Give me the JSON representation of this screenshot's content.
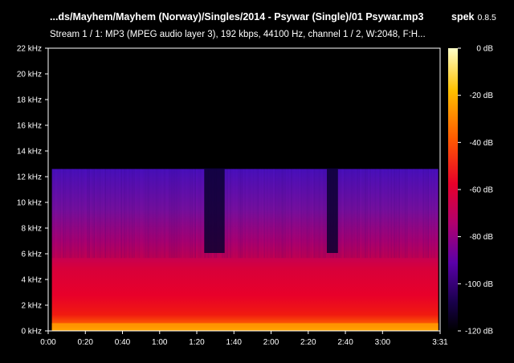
{
  "header": {
    "title": "...ds/Mayhem/Mayhem (Norway)/Singles/2014 - Psywar (Single)/01 Psywar.mp3",
    "app_name": "spek",
    "app_version": "0.8.5",
    "stream_info": "Stream 1 / 1: MP3 (MPEG audio layer 3), 192 kbps, 44100 Hz, channel 1 / 2, W:2048, F:H..."
  },
  "colors": {
    "background": "#000000",
    "text": "#ffffff",
    "palette": [
      "#000000",
      "#18004a",
      "#5a00a8",
      "#b0006e",
      "#e8002a",
      "#ff5a00",
      "#ffc000",
      "#ffffc8"
    ]
  },
  "chart_data": {
    "type": "heatmap",
    "title": "",
    "xlabel": "",
    "ylabel": "",
    "x_range": [
      "0:00",
      "3:31"
    ],
    "y_range_khz": [
      0,
      22
    ],
    "x_ticks": [
      "0:00",
      "0:20",
      "0:40",
      "1:00",
      "1:20",
      "1:40",
      "2:00",
      "2:20",
      "2:40",
      "3:00",
      "3:31"
    ],
    "y_ticks": [
      "0 kHz",
      "2 kHz",
      "4 kHz",
      "6 kHz",
      "8 kHz",
      "10 kHz",
      "12 kHz",
      "14 kHz",
      "16 kHz",
      "18 kHz",
      "20 kHz",
      "22 kHz"
    ],
    "colorbar_ticks": [
      "0 dB",
      "-20 dB",
      "-40 dB",
      "-60 dB",
      "-80 dB",
      "-100 dB",
      "-120 dB"
    ],
    "colorbar_range_db": [
      -120,
      0
    ],
    "cutoff_khz": 12.6,
    "quiet_sections_seconds": [
      [
        84,
        95
      ],
      [
        150,
        156
      ]
    ]
  }
}
